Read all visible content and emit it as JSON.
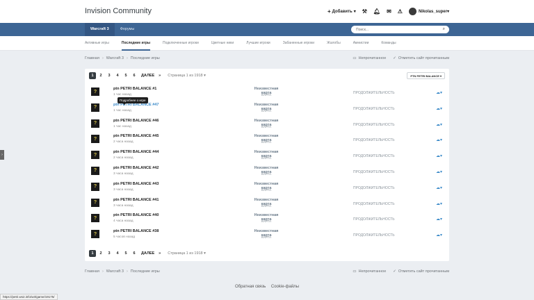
{
  "header": {
    "title": "Invision Community",
    "add_label": "Добавить",
    "user_name": "Nikolas_super"
  },
  "nav": {
    "tabs": [
      {
        "label": "Warcraft 3",
        "active": true
      },
      {
        "label": "Форумы",
        "active": false
      }
    ],
    "search_placeholder": "Поиск..."
  },
  "subnav": {
    "items": [
      "Активные игры",
      "Последние игры",
      "Подключенные игроки",
      "Цветные ники",
      "Лучшие игроки",
      "Забаненные игроки",
      "Жалобы",
      "Амнистии",
      "Команды"
    ],
    "active_index": 1
  },
  "breadcrumb": {
    "items": [
      "Главная",
      "Warcraft 3",
      "Последние игры"
    ],
    "unread_label": "Непрочитанное",
    "mark_read_label": "Отметить сайт прочитанным"
  },
  "pager": {
    "pages": [
      "1",
      "2",
      "3",
      "4",
      "5",
      "6"
    ],
    "next_label": "ДАЛЕЕ",
    "last_label": "»",
    "page_of": "Страница 1 из 1918"
  },
  "filter_label": "PTN PETRI BALANCE",
  "tooltip": "Подробнее о игре",
  "games": [
    {
      "title": "ptn PETRI BALANCE #1",
      "time": "1 час назад",
      "map": "Неизвестная карта",
      "map_label": "КАРТА",
      "duration": "ПРОДОЛЖИТЕЛЬНОСТЬ"
    },
    {
      "title": "ptn PETRI BALANCE #47",
      "time": "1 час назад",
      "map": "Неизвестная карта",
      "map_label": "КАРТА",
      "duration": "ПРОДОЛЖИТЕЛЬНОСТЬ"
    },
    {
      "title": "ptn PETRI BALANCE #46",
      "time": "1 час назад",
      "map": "Неизвестная карта",
      "map_label": "КАРТА",
      "duration": "ПРОДОЛЖИТЕЛЬНОСТЬ"
    },
    {
      "title": "ptn PETRI BALANCE #45",
      "time": "2 часа назад",
      "map": "Неизвестная карта",
      "map_label": "КАРТА",
      "duration": "ПРОДОЛЖИТЕЛЬНОСТЬ"
    },
    {
      "title": "ptn PETRI BALANCE #44",
      "time": "2 часа назад",
      "map": "Неизвестная карта",
      "map_label": "КАРТА",
      "duration": "ПРОДОЛЖИТЕЛЬНОСТЬ"
    },
    {
      "title": "ptn PETRI BALANCE #42",
      "time": "3 часа назад",
      "map": "Неизвестная карта",
      "map_label": "КАРТА",
      "duration": "ПРОДОЛЖИТЕЛЬНОСТЬ"
    },
    {
      "title": "ptn PETRI BALANCE #43",
      "time": "3 часа назад",
      "map": "Неизвестная карта",
      "map_label": "КАРТА",
      "duration": "ПРОДОЛЖИТЕЛЬНОСТЬ"
    },
    {
      "title": "ptn PETRI BALANCE #41",
      "time": "3 часа назад",
      "map": "Неизвестная карта",
      "map_label": "КАРТА",
      "duration": "ПРОДОЛЖИТЕЛЬНОСТЬ"
    },
    {
      "title": "ptn PETRI BALANCE #40",
      "time": "4 часа назад",
      "map": "Неизвестная карта",
      "map_label": "КАРТА",
      "duration": "ПРОДОЛЖИТЕЛЬНОСТЬ"
    },
    {
      "title": "ptn PETRI BALANCE #38",
      "time": "5 часов назад",
      "map": "Неизвестная карта",
      "map_label": "КАРТА",
      "duration": "ПРОДОЛЖИТЕЛЬНОСТЬ"
    }
  ],
  "footer": {
    "contact": "Обратная связь",
    "cookies": "Cookie-файлы"
  },
  "status_url": "https://petri.ws2.info/w3/game/19175/",
  "colors": {
    "nav_bg": "#3d6594",
    "link": "#3d8bc9",
    "accent_dark": "#353c41"
  }
}
